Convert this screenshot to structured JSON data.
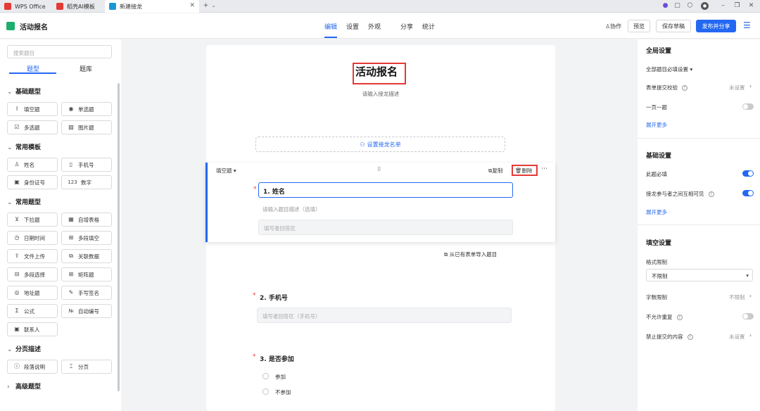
{
  "tabs": [
    {
      "label": "WPS Office",
      "color": "#e53935"
    },
    {
      "label": "稻壳AI模板",
      "color": "#e53935"
    },
    {
      "label": "新建接龙",
      "color": "#1a98d5"
    }
  ],
  "header": {
    "app_title": "活动报名",
    "nav": [
      "编辑",
      "设置",
      "外观",
      "分享",
      "统计"
    ],
    "collab": "协作",
    "preview": "预览",
    "save_draft": "保存草稿",
    "publish": "发布并分享"
  },
  "left": {
    "search_placeholder": "搜索题目",
    "tabs": [
      "题型",
      "题库"
    ],
    "sections": [
      {
        "title": "基础题型",
        "items": [
          "填空题",
          "单选题",
          "多选题",
          "图片题"
        ]
      },
      {
        "title": "常用模板",
        "items": [
          "姓名",
          "手机号",
          "身份证号",
          "数字"
        ]
      },
      {
        "title": "常用题型",
        "items": [
          "下拉题",
          "自增表格",
          "日期时间",
          "多段填空",
          "文件上传",
          "关联数据",
          "多段选择",
          "矩阵题",
          "地址题",
          "手写签名",
          "公式",
          "自动编号",
          "联系人"
        ]
      },
      {
        "title": "分页描述",
        "items": [
          "段落说明",
          "分页"
        ]
      },
      {
        "title": "高级题型",
        "items": []
      }
    ]
  },
  "form": {
    "title": "活动报名",
    "description": "请输入接龙描述",
    "set_list": "设置接龙名单",
    "active_type": "填空题",
    "copy": "复制",
    "delete": "删除",
    "q1_title": "1. 姓名",
    "q1_desc": "请输入题目描述（选填）",
    "q1_placeholder": "填写者回答区",
    "import": "从已有表单导入题目",
    "q2_title": "2. 手机号",
    "q2_placeholder": "填写者回答区（手机号）",
    "q3_title": "3. 是否参加",
    "q3_options": [
      "参加",
      "不参加"
    ]
  },
  "right": {
    "global_title": "全局设置",
    "required_setting": "全部题目必填设置",
    "submit_check": "表单提交校验",
    "submit_check_val": "未设置",
    "one_page": "一页一题",
    "expand1": "展开更多",
    "basic_title": "基础设置",
    "required": "此题必填",
    "mutual_visible": "接龙参与者之间互相可见",
    "expand2": "展开更多",
    "fill_title": "填空设置",
    "format_limit": "格式限制",
    "format_value": "不限制",
    "char_limit": "字数限制",
    "char_limit_val": "不限制",
    "no_repeat": "不允许重复",
    "forbid_content": "禁止提交的内容",
    "forbid_val": "未设置"
  },
  "colors": {
    "accent": "#2468f2",
    "highlight": "#e53935"
  }
}
